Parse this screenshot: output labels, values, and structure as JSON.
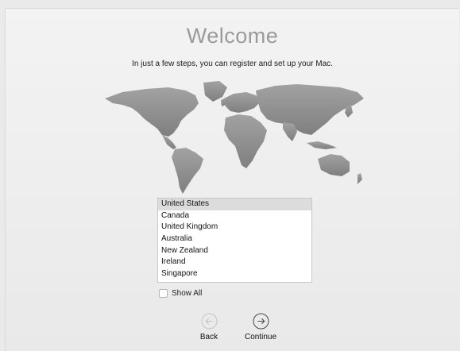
{
  "window": {
    "title": "Welcome",
    "subtitle": "In just a few steps, you can register and set up your Mac."
  },
  "country_list": {
    "items": [
      "United States",
      "Canada",
      "United Kingdom",
      "Australia",
      "New Zealand",
      "Ireland",
      "Singapore"
    ],
    "selected_index": 0
  },
  "show_all": {
    "label": "Show All",
    "checked": false
  },
  "navigation": {
    "back_label": "Back",
    "back_icon": "arrow-left-circle-icon",
    "continue_label": "Continue",
    "continue_icon": "arrow-right-circle-icon"
  },
  "colors": {
    "title": "#9a9a9a",
    "map": "#8f8f8f",
    "selection": "#dcdcdc",
    "background": "#efefef"
  }
}
